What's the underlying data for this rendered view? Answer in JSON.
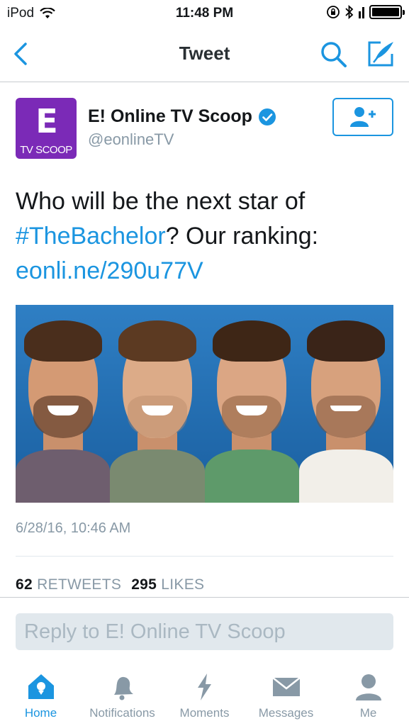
{
  "status_bar": {
    "carrier": "iPod",
    "time": "11:48 PM"
  },
  "nav": {
    "title": "Tweet",
    "back_icon": "chevron-left-icon",
    "search_icon": "search-icon",
    "compose_icon": "compose-icon"
  },
  "tweet": {
    "avatar": {
      "logo_text": "E",
      "logo_sub": "TV SCOOP",
      "color": "#7b2ab7"
    },
    "user_name": "E! Online TV Scoop",
    "handle": "@eonlineTV",
    "verified": true,
    "text_prefix": "Who will be the next star of",
    "hashtag": "#TheBachelor",
    "text_suffix": "? Our ranking:",
    "link": "eonli.ne/290u77V",
    "timestamp": "6/28/16, 10:46 AM",
    "retweets_count": "62",
    "retweets_label": "RETWEETS",
    "likes_count": "295",
    "likes_label": "LIKES"
  },
  "reply": {
    "placeholder": "Reply to E! Online TV Scoop"
  },
  "tabs": [
    {
      "label": "Home",
      "icon": "home-icon",
      "active": true
    },
    {
      "label": "Notifications",
      "icon": "bell-icon",
      "active": false
    },
    {
      "label": "Moments",
      "icon": "lightning-icon",
      "active": false
    },
    {
      "label": "Messages",
      "icon": "envelope-icon",
      "active": false
    },
    {
      "label": "Me",
      "icon": "person-icon",
      "active": false
    }
  ],
  "colors": {
    "accent": "#1b95e0",
    "muted": "#8899a6",
    "text": "#14171a"
  }
}
